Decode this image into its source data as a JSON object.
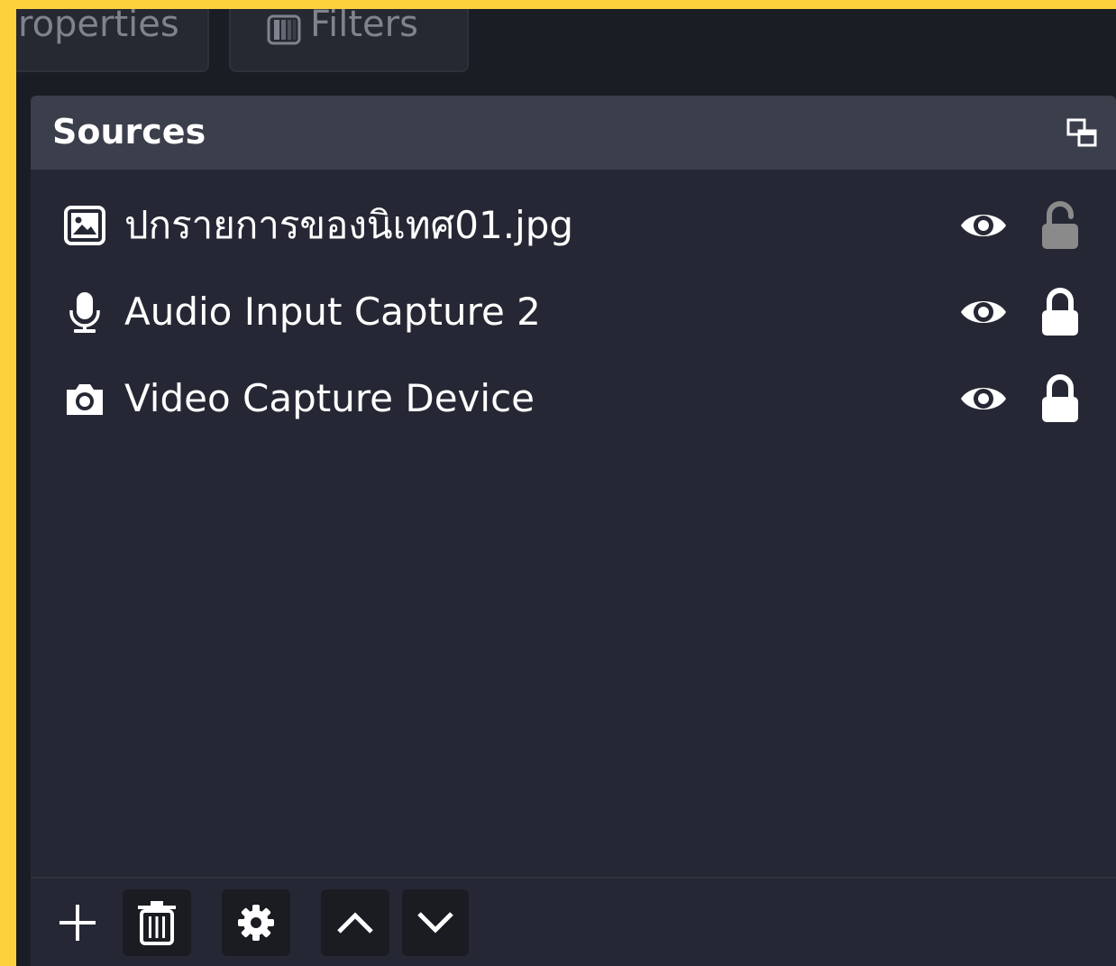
{
  "tabs": [
    {
      "label": "roperties"
    },
    {
      "label": "Filters",
      "icon": "filter-icon"
    }
  ],
  "sources_dock": {
    "title": "Sources",
    "float_icon": "undock-icon",
    "items": [
      {
        "name": "ปกรายการของนิเทศ01.jpg",
        "icon": "image-icon",
        "visible": true,
        "locked": false
      },
      {
        "name": "Audio Input Capture 2",
        "icon": "microphone-icon",
        "visible": true,
        "locked": true
      },
      {
        "name": "Video Capture Device",
        "icon": "camera-icon",
        "visible": true,
        "locked": true
      }
    ]
  },
  "toolbar": {
    "buttons": [
      {
        "action": "add",
        "icon": "plus-icon"
      },
      {
        "action": "remove",
        "icon": "trash-icon"
      },
      {
        "action": "properties",
        "icon": "gear-icon"
      },
      {
        "action": "move-up",
        "icon": "chevron-up-icon"
      },
      {
        "action": "move-down",
        "icon": "chevron-down-icon"
      }
    ]
  },
  "colors": {
    "frame": "#fcd13b",
    "background": "#1b1d24",
    "dock": "#252834",
    "header": "#3b3e4b",
    "text": "#ffffff",
    "muted": "#7f838d",
    "unlocked_icon": "#8a8a8a"
  }
}
